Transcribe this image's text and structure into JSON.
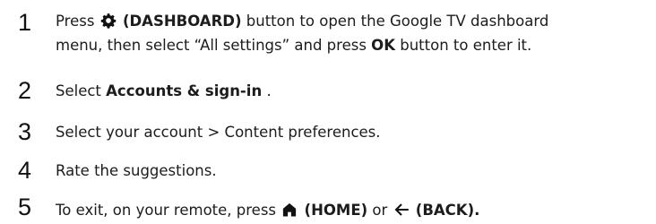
{
  "steps": [
    {
      "number": "1",
      "line1_pre": "Press",
      "line1_bold": "(DASHBOARD)",
      "line1_post": "button to open the Google TV dashboard",
      "line2_pre": "menu, then select “All settings” and press",
      "line2_bold": "OK",
      "line2_post": "button to enter it.",
      "icon": "gear-icon"
    },
    {
      "number": "2",
      "pre": "Select",
      "bold": "Accounts & sign-in",
      "post": "."
    },
    {
      "number": "3",
      "text": "Select your account > Content preferences."
    },
    {
      "number": "4",
      "text": "Rate the suggestions."
    },
    {
      "number": "5",
      "pre": "To exit, on your remote, press",
      "bold1": "(HOME)",
      "mid": "or",
      "bold2": "(BACK).",
      "icon1": "home-icon",
      "icon2": "back-arrow-icon"
    }
  ]
}
